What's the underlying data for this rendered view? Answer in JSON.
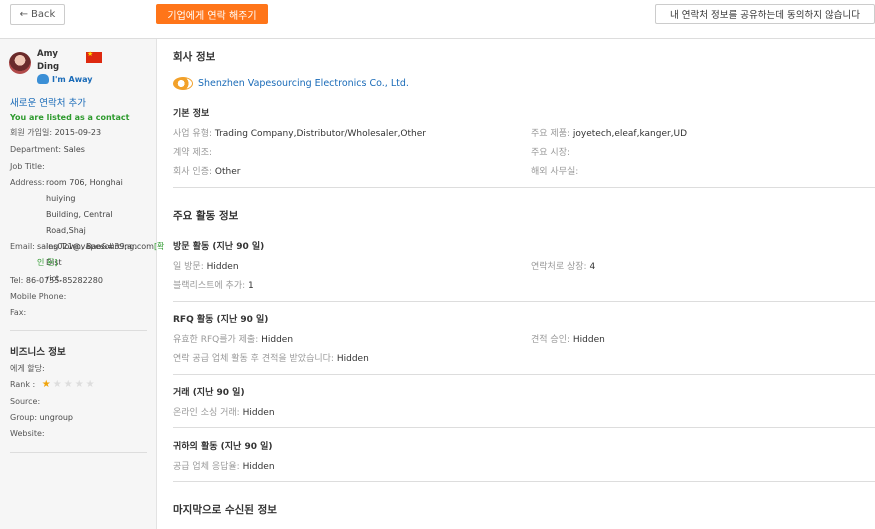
{
  "topbar": {
    "back_label": "Back",
    "contact_label": "기업에게 연락 해주기",
    "decline_label": "내 연락처 정보를 공유하는데 동의하지 않습니다"
  },
  "sidebar": {
    "name_first": "Amy",
    "name_last": "Ding",
    "status": "I'm Away",
    "add_contact": "새로운 연락처 추가",
    "listed": "You are listed as a contact",
    "member_since_label": "회원 가입일:",
    "member_since": "2015-09-23",
    "department_label": "Department:",
    "department": "Sales",
    "job_title_label": "Job Title:",
    "address_label": "Address:",
    "address_lines": [
      "room 706, Honghai huiying",
      "Building, Central Road,Shaj",
      "ing Town, Bao&#39;an Dist",
      "rict,"
    ],
    "email_label": "Email:",
    "email": "sales021@vapesourcing.com",
    "email_confirm_1": "[확",
    "email_confirm_2": "인 된]",
    "tel_label": "Tel:",
    "tel": "86-0755-85282280",
    "mobile_label": "Mobile Phone:",
    "fax_label": "Fax:",
    "biz_title": "비즈니스 정보",
    "assigned_label": "에게 할당:",
    "rank_label": "Rank :",
    "rank": 1,
    "rank_max": 5,
    "source_label": "Source:",
    "group_label": "Group:",
    "group": "ungroup",
    "website_label": "Website:"
  },
  "main": {
    "company_title": "회사 정보",
    "company_name": "Shenzhen Vapesourcing Electronics Co., Ltd.",
    "basic_title": "기본 정보",
    "business_type_label": "사업 유형:",
    "business_type": "Trading Company,Distributor/Wholesaler,Other",
    "main_products_label": "주요 제품:",
    "main_products": "joyetech,eleaf,kanger,UD",
    "contract_mfg_label": "계약 제조:",
    "main_markets_label": "주요 시장:",
    "certification_label": "회사 인증:",
    "certification": "Other",
    "overseas_label": "해외 사무실:",
    "activity_title": "주요 활동 정보",
    "visit_title": "방문 활동 (지난 90 일)",
    "visit_days_label": "일 방문:",
    "visit_days": "Hidden",
    "contact_listed_label": "연락처로 상장:",
    "contact_listed": "4",
    "blacklisted_label": "블랙리스트에 추가:",
    "blacklisted": "1",
    "rfq_title": "RFQ 활동 (지난 90 일)",
    "rfq_submitted_label": "유효한 RFQ를가 제출:",
    "rfq_submitted": "Hidden",
    "quote_accepted_label": "견적 승인:",
    "quote_accepted": "Hidden",
    "quotes_received_label": "연락 공급 업체 활동 후 견적을 받았습니다:",
    "quotes_received": "Hidden",
    "trade_title": "거래 (지난 90 일)",
    "online_trade_label": "온라인 소싱 거래:",
    "online_trade": "Hidden",
    "your_activity_title": "귀하의 활동 (지난 90 일)",
    "supplier_reply_label": "공급 업체 응답율:",
    "supplier_reply": "Hidden",
    "last_received_title": "마지막으로 수신된 정보"
  },
  "colors": {
    "accent_orange": "#ff7519",
    "link_blue": "#1a6bb8",
    "green": "#2e9a2e",
    "star_gold": "#f0a30a"
  }
}
